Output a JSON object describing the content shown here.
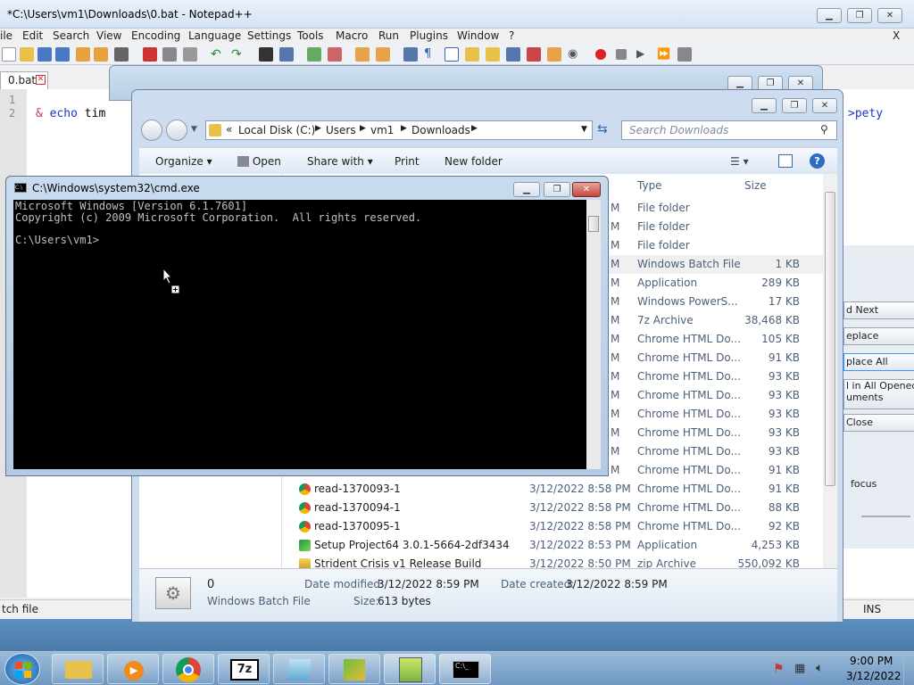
{
  "notepadpp": {
    "title": "*C:\\Users\\vm1\\Downloads\\0.bat - Notepad++",
    "menu": [
      "ile",
      "Edit",
      "Search",
      "View",
      "Encoding",
      "Language",
      "Settings",
      "Tools",
      "Macro",
      "Run",
      "Plugins",
      "Window",
      "?"
    ],
    "menu_close": "X",
    "tab_label": "0.bat",
    "line_numbers": [
      "1",
      "2"
    ],
    "code_line2": "& echo tim",
    "code_right": ">pety",
    "status_left": "tch file",
    "status_ins": "INS"
  },
  "find_dialog": {
    "buttons": [
      "d Next",
      "eplace",
      "place All",
      "l in All Opened\numents",
      "Close"
    ],
    "focus_label": "focus"
  },
  "explorer": {
    "breadcrumb": [
      "«",
      "Local Disk (C:)",
      "Users",
      "vm1",
      "Downloads"
    ],
    "search_placeholder": "Search Downloads",
    "commands": [
      "Organize",
      "Open",
      "Share with",
      "Print",
      "New folder"
    ],
    "columns": {
      "type": "Type",
      "size": "Size"
    },
    "rows": [
      {
        "date": "M",
        "type": "File folder",
        "size": ""
      },
      {
        "date": "M",
        "type": "File folder",
        "size": ""
      },
      {
        "date": "M",
        "type": "File folder",
        "size": ""
      },
      {
        "date": "M",
        "type": "Windows Batch File",
        "size": "1 KB",
        "selected": true
      },
      {
        "date": "M",
        "type": "Application",
        "size": "289 KB"
      },
      {
        "date": "M",
        "type": "Windows PowerS...",
        "size": "17 KB"
      },
      {
        "date": "M",
        "type": "7z Archive",
        "size": "38,468 KB"
      },
      {
        "date": "M",
        "type": "Chrome HTML Do...",
        "size": "105 KB"
      },
      {
        "date": "M",
        "type": "Chrome HTML Do...",
        "size": "91 KB"
      },
      {
        "date": "M",
        "type": "Chrome HTML Do...",
        "size": "93 KB"
      },
      {
        "date": "M",
        "type": "Chrome HTML Do...",
        "size": "93 KB"
      },
      {
        "date": "M",
        "type": "Chrome HTML Do...",
        "size": "93 KB"
      },
      {
        "date": "M",
        "type": "Chrome HTML Do...",
        "size": "93 KB"
      },
      {
        "date": "M",
        "type": "Chrome HTML Do...",
        "size": "93 KB"
      },
      {
        "date": "M",
        "type": "Chrome HTML Do...",
        "size": "91 KB"
      },
      {
        "name": "read-1370093-1",
        "date": "3/12/2022 8:58 PM",
        "type": "Chrome HTML Do...",
        "size": "91 KB",
        "icon": "chrome-icon"
      },
      {
        "name": "read-1370094-1",
        "date": "3/12/2022 8:58 PM",
        "type": "Chrome HTML Do...",
        "size": "88 KB",
        "icon": "chrome-icon"
      },
      {
        "name": "read-1370095-1",
        "date": "3/12/2022 8:58 PM",
        "type": "Chrome HTML Do...",
        "size": "92 KB",
        "icon": "chrome-icon"
      },
      {
        "name": "Setup Project64 3.0.1-5664-2df3434",
        "date": "3/12/2022 8:53 PM",
        "type": "Application",
        "size": "4,253 KB",
        "icon": "setup-icon"
      },
      {
        "name": "Strident Crisis v1 Release Build",
        "date": "3/12/2022 8:50 PM",
        "type": "zip Archive",
        "size": "550,092 KB",
        "icon": "zip-icon"
      }
    ],
    "details": {
      "name": "0",
      "type": "Windows Batch File",
      "modified_label": "Date modified:",
      "modified_value": "3/12/2022 8:59 PM",
      "created_label": "Date created:",
      "created_value": "3/12/2022 8:59 PM",
      "size_label": "Size:",
      "size_value": "613 bytes"
    }
  },
  "cmd": {
    "title": "C:\\Windows\\system32\\cmd.exe",
    "console_text": "Microsoft Windows [Version 6.1.7601]\nCopyright (c) 2009 Microsoft Corporation.  All rights reserved.\n\nC:\\Users\\vm1>"
  },
  "taskbar": {
    "time": "9:00 PM",
    "date": "3/12/2022",
    "apps": [
      "windows-explorer",
      "media-player",
      "chrome",
      "7-zip",
      "notepad",
      "winmerge",
      "notepad-plus-plus",
      "cmd"
    ]
  },
  "colors": {
    "accent": "#3399ff",
    "console_bg": "#000000",
    "close_red": "#c2483a"
  }
}
